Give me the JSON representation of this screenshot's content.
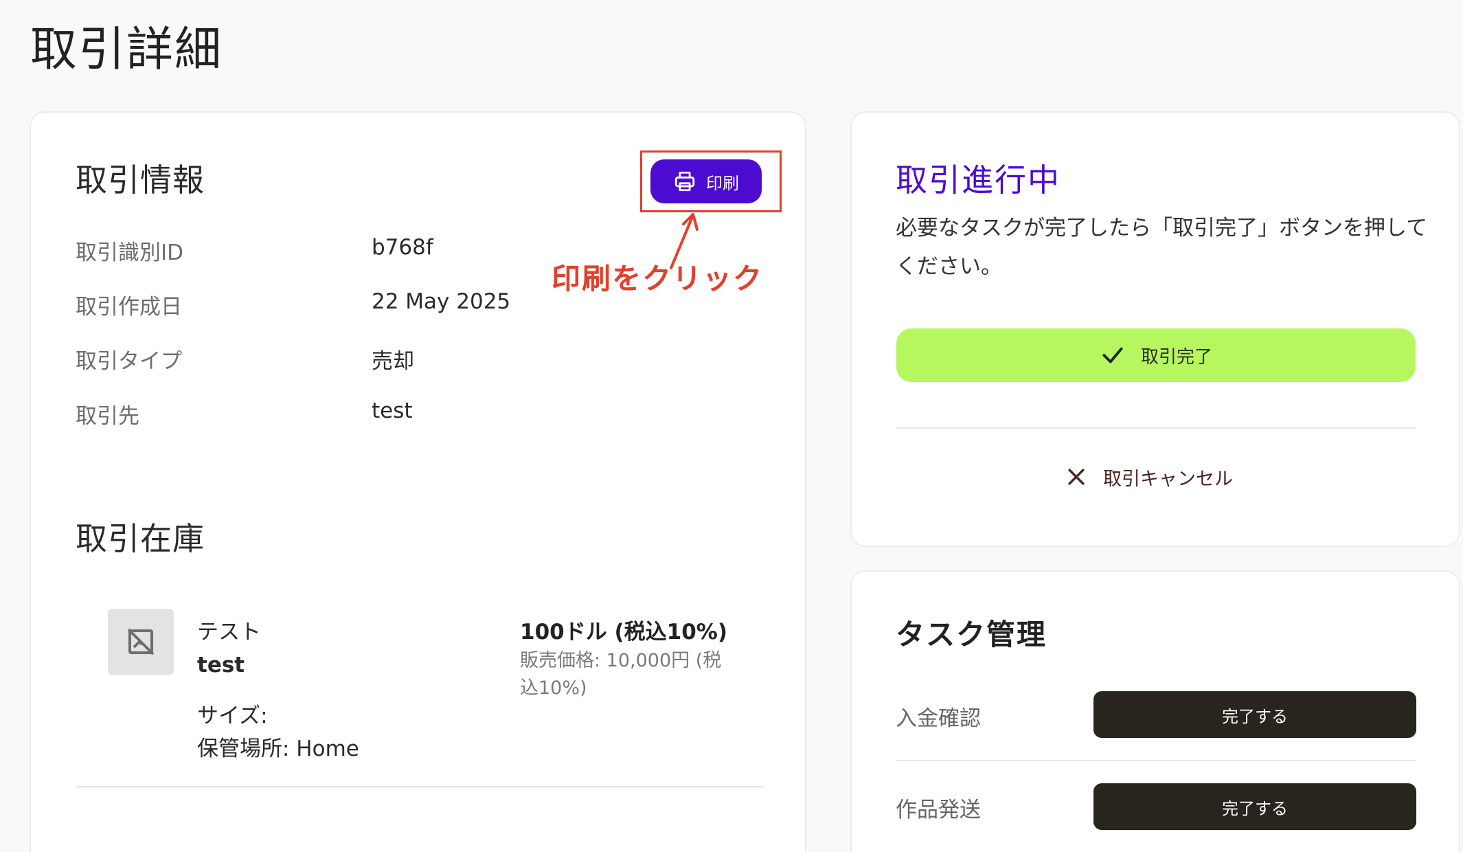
{
  "page": {
    "title": "取引詳細"
  },
  "info": {
    "section_title": "取引情報",
    "print_label": "印刷",
    "annotation": "印刷をクリック",
    "rows": [
      {
        "label": "取引識別ID",
        "value": "b768f"
      },
      {
        "label": "取引作成日",
        "value": "22 May 2025"
      },
      {
        "label": "取引タイプ",
        "value": "売却"
      },
      {
        "label": "取引先",
        "value": "test"
      }
    ]
  },
  "inventory": {
    "section_title": "取引在庫",
    "item": {
      "name": "テスト",
      "subname": "test",
      "size": "サイズ:",
      "location": "保管場所: Home",
      "price": "100ドル (税込10%)",
      "sale_price": "販売価格: 10,000円 (税込10%)"
    }
  },
  "status": {
    "title": "取引進行中",
    "description": "必要なタスクが完了したら「取引完了」ボタンを押してください。",
    "complete_label": "取引完了",
    "cancel_label": "取引キャンセル"
  },
  "tasks": {
    "title": "タスク管理",
    "items": [
      {
        "label": "入金確認",
        "button": "完了する"
      },
      {
        "label": "作品発送",
        "button": "完了する"
      }
    ]
  },
  "colors": {
    "accent": "#4c0bd1",
    "complete": "#b6f65f",
    "annotation": "#e53e2b",
    "task_button": "#28241e"
  }
}
